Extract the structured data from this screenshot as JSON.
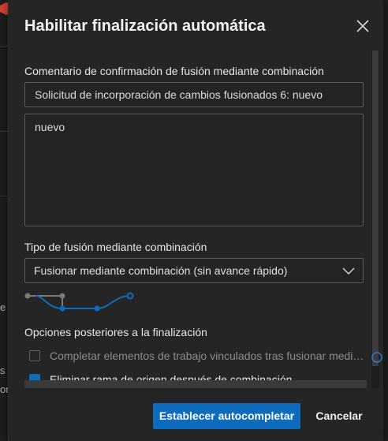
{
  "background": {
    "fragment_1": "e",
    "fragment_2": "s p",
    "fragment_3": "or"
  },
  "dialog": {
    "title": "Habilitar finalización automática",
    "commit_message_label": "Comentario de confirmación de fusión mediante combinación",
    "commit_title_value": "Solicitud de incorporación de cambios fusionados 6: nuevo",
    "commit_body_value": "nuevo",
    "merge_type_label": "Tipo de fusión mediante combinación",
    "merge_type_selected": "Fusionar mediante combinación (sin avance rápido)",
    "post_completion_label": "Opciones posteriores a la finalización",
    "options": [
      {
        "label": "Completar elementos de trabajo vinculados tras fusionar medi…",
        "checked": false
      },
      {
        "label": "Eliminar rama de origen después de combinación",
        "checked": true
      }
    ],
    "primary_button": "Establecer autocompletar",
    "cancel_button": "Cancelar"
  },
  "colors": {
    "accent": "#0f6cbd",
    "dialog_bg": "#252525",
    "border": "#5a5a5a"
  },
  "icons": {
    "close": "close-icon",
    "dropdown": "chevron-down-icon",
    "merge_graph": "merge-graph-icon",
    "info": "info-icon"
  }
}
